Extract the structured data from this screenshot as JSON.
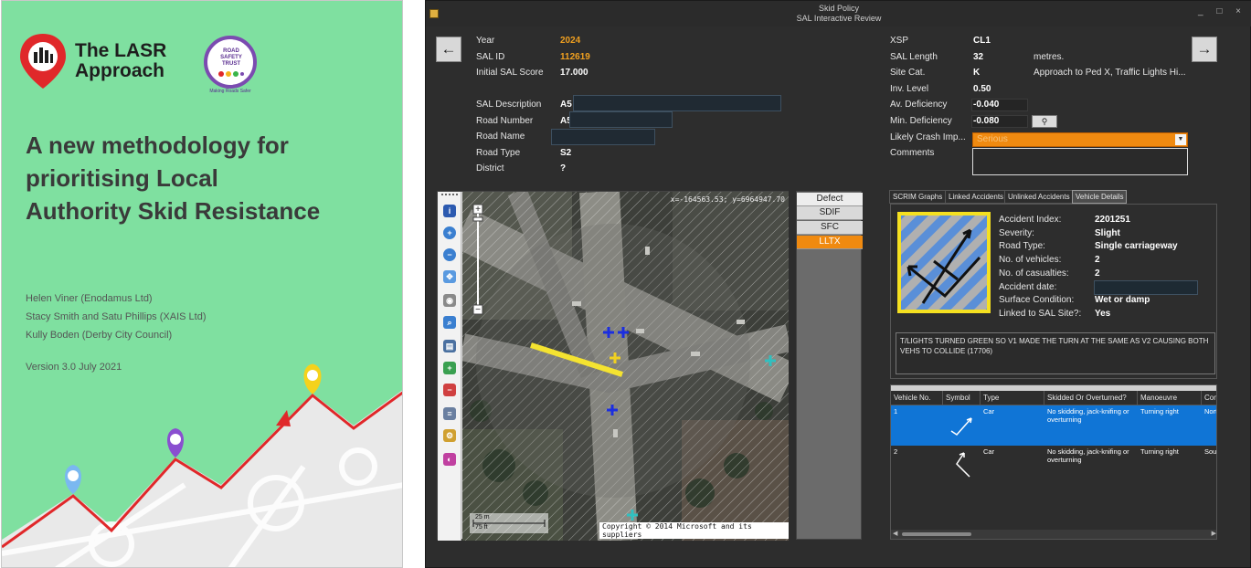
{
  "cover": {
    "logo_text_line1": "The LASR",
    "logo_text_line2": "Approach",
    "partner_logo_text": "ROAD SAFETY TRUST",
    "partner_tagline": "Making Roads Safer",
    "title": "A new methodology for prioritising Local Authority Skid Resistance",
    "authors": [
      "Helen Viner (Enodamus Ltd)",
      "Stacy Smith and Satu Phillips (XAIS Ltd)",
      "Kully Boden (Derby City Council)"
    ],
    "version": "Version 3.0    July 2021",
    "colors": {
      "background": "#7fe0a0",
      "accent_red": "#e0282a",
      "pin_yellow": "#f5d21c",
      "pin_purple": "#8a4fd0",
      "pin_blue": "#7ab8f0"
    }
  },
  "window": {
    "title": "Skid Policy",
    "subtitle": "SAL Interactive Review",
    "controls": "_ □ ×",
    "prev_icon": "arrow-left-icon",
    "next_icon": "arrow-right-icon"
  },
  "fields_left": [
    {
      "label": "Year",
      "value": "2024",
      "highlight": true
    },
    {
      "label": "SAL ID",
      "value": "112619",
      "highlight": true
    },
    {
      "label": "Initial SAL Score",
      "value": "17.000"
    },
    {
      "label": "SAL Description",
      "value": "A5"
    },
    {
      "label": "Road Number",
      "value": "A5"
    },
    {
      "label": "Road Name",
      "value": ""
    },
    {
      "label": "Road Type",
      "value": "S2"
    },
    {
      "label": "District",
      "value": "?"
    }
  ],
  "fields_right": [
    {
      "label": "XSP",
      "value": "CL1"
    },
    {
      "label": "SAL Length",
      "value": "32",
      "unit": "metres."
    },
    {
      "label": "Site Cat.",
      "value": "K",
      "extra": "Approach to Ped X, Traffic Lights  Hi..."
    },
    {
      "label": "Inv. Level",
      "value": "0.50"
    },
    {
      "label": "Av. Deficiency",
      "value": "-0.040"
    },
    {
      "label": "Min. Deficiency",
      "value": "-0.080"
    },
    {
      "label": "Likely Crash Imp...",
      "value": "Serious"
    },
    {
      "label": "Comments",
      "value": ""
    }
  ],
  "map": {
    "coordinates": "x=-164563.53; y=6964947.70",
    "copyright": "Copyright © 2014 Microsoft and its suppliers",
    "scale_m": "25 m",
    "scale_ft": "75 ft",
    "tools": [
      "info-icon",
      "zoom-in-icon",
      "zoom-out-icon",
      "pan-icon",
      "identify-icon",
      "find-icon",
      "layers-icon",
      "add-layer-icon",
      "remove-layer-icon",
      "properties-icon",
      "settings-icon",
      "palette-icon"
    ]
  },
  "layers": {
    "header": "Defect",
    "items": [
      "SDIF",
      "SFC",
      "LLTX"
    ],
    "selected": "LLTX"
  },
  "tabs": [
    "SCRIM Graphs",
    "Linked Accidents",
    "Unlinked Accidents",
    "Vehicle Details"
  ],
  "active_tab": "Vehicle Details",
  "accident": [
    {
      "label": "Accident Index:",
      "value": "2201251"
    },
    {
      "label": "Severity:",
      "value": "Slight"
    },
    {
      "label": "Road Type:",
      "value": "Single carriageway"
    },
    {
      "label": "No. of vehicles:",
      "value": "2"
    },
    {
      "label": "No. of casualties:",
      "value": "2"
    },
    {
      "label": "Accident date:",
      "value": ""
    },
    {
      "label": "Surface Condition:",
      "value": "Wet or damp"
    },
    {
      "label": "Linked to SAL Site?:",
      "value": "Yes"
    }
  ],
  "narrative": "T/LIGHTS TURNED GREEN SO V1 MADE THE TURN AT THE SAME AS V2 CAUSING BOTH VEHS TO COLLIDE (17706)",
  "vehicle_grid": {
    "columns": [
      "Vehicle No.",
      "Symbol",
      "Type",
      "Skidded Or Overturned?",
      "Manoeuvre",
      "Compass"
    ],
    "rows": [
      {
        "no": "1",
        "symbol": "turn-right-arrow-icon",
        "type": "Car",
        "skidded": "No skidding, jack-knifing or overturning",
        "manoeuvre": "Turning right",
        "compass": "North",
        "selected": true
      },
      {
        "no": "2",
        "symbol": "turn-right-arrow-icon",
        "type": "Car",
        "skidded": "No skidding, jack-knifing or overturning",
        "manoeuvre": "Turning right",
        "compass": "South",
        "selected": false
      }
    ]
  }
}
